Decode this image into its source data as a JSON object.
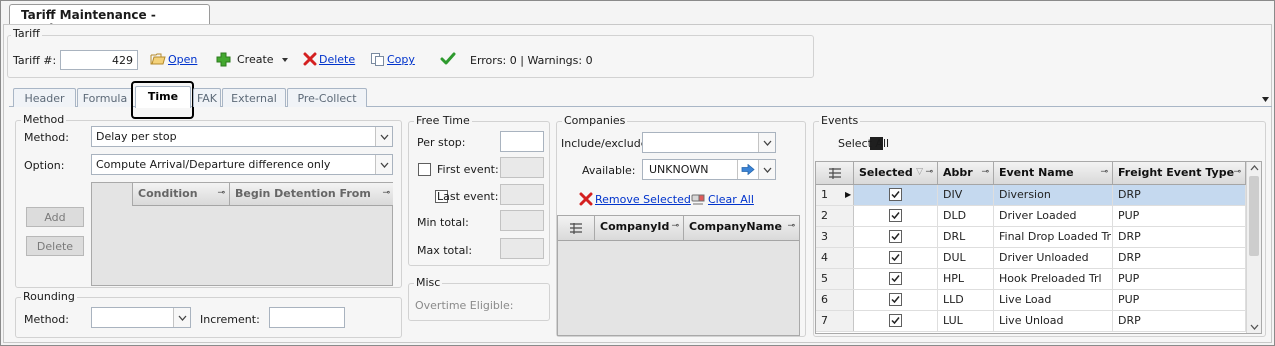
{
  "window": {
    "title": "Tariff Maintenance - Settlement"
  },
  "tariff_group": {
    "label": "Tariff",
    "tariff_no_label": "Tariff #:",
    "tariff_no_value": "429",
    "open_label": "Open",
    "create_label": "Create",
    "delete_label": "Delete",
    "copy_label": "Copy",
    "status_text": "Errors: 0 | Warnings: 0"
  },
  "tabs": [
    {
      "label": "Header"
    },
    {
      "label": "Formula"
    },
    {
      "label": "Time"
    },
    {
      "label": "FAK"
    },
    {
      "label": "External"
    },
    {
      "label": "Pre-Collect"
    }
  ],
  "method_group": {
    "label": "Method",
    "method_label": "Method:",
    "method_value": "Delay per stop",
    "option_label": "Option:",
    "option_value": "Compute Arrival/Departure difference only",
    "add_label": "Add",
    "delete_label": "Delete",
    "columns": [
      "Condition",
      "Begin Detention From"
    ]
  },
  "rounding_group": {
    "label": "Rounding",
    "method_label": "Method:",
    "method_value": "",
    "increment_label": "Increment:",
    "increment_value": ""
  },
  "free_time_group": {
    "label": "Free Time",
    "per_stop_label": "Per stop:",
    "first_event_label": "First event:",
    "last_event_label": "Last event:",
    "min_total_label": "Min total:",
    "max_total_label": "Max total:"
  },
  "misc_group": {
    "label": "Misc",
    "overtime_label": "Overtime Eligible:"
  },
  "companies_group": {
    "label": "Companies",
    "include_label": "Include/exclude:",
    "include_value": "",
    "available_label": "Available:",
    "available_value": "UNKNOWN",
    "remove_selected_label": "Remove Selected",
    "clear_all_label": "Clear All",
    "columns": [
      "CompanyId",
      "CompanyName"
    ]
  },
  "events_group": {
    "label": "Events",
    "select_all_label": "Select All",
    "columns": [
      "Selected",
      "Abbr",
      "Event Name",
      "Freight Event Type"
    ],
    "rows": [
      {
        "num": "1",
        "abbr": "DIV",
        "name": "Diversion",
        "type": "DRP"
      },
      {
        "num": "2",
        "abbr": "DLD",
        "name": "Driver Loaded",
        "type": "PUP"
      },
      {
        "num": "3",
        "abbr": "DRL",
        "name": "Final Drop Loaded Tr",
        "type": "DRP"
      },
      {
        "num": "4",
        "abbr": "DUL",
        "name": "Driver Unloaded",
        "type": "DRP"
      },
      {
        "num": "5",
        "abbr": "HPL",
        "name": "Hook Preloaded Trl",
        "type": "PUP"
      },
      {
        "num": "6",
        "abbr": "LLD",
        "name": "Live Load",
        "type": "PUP"
      },
      {
        "num": "7",
        "abbr": "LUL",
        "name": "Live Unload",
        "type": "DRP"
      }
    ]
  },
  "colors": {
    "accent_link": "#0033cc",
    "selected_row": "#c5d9ef",
    "tab_border": "#a9b6c6",
    "check_green": "#2e9a2e",
    "delete_red": "#d42020"
  }
}
